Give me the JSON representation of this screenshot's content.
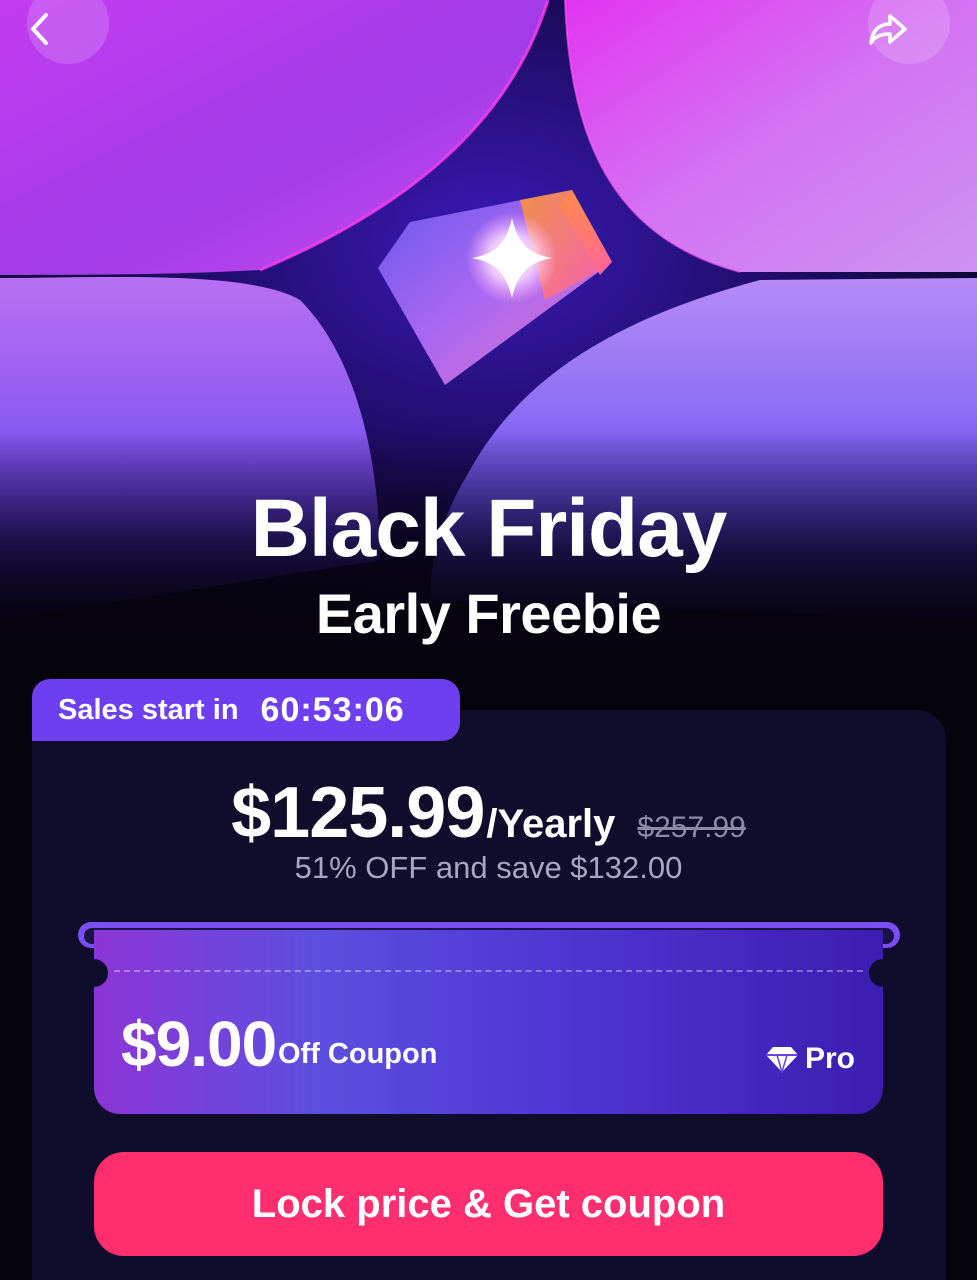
{
  "hero": {
    "title": "Black Friday",
    "subtitle": "Early Freebie",
    "back_icon": "chevron-left-icon",
    "share_icon": "share-arrow-icon"
  },
  "countdown": {
    "label": "Sales start in",
    "value": "60:53:06"
  },
  "pricing": {
    "price": "$125.99",
    "period": "/Yearly",
    "original_price": "$257.99",
    "savings_text": "51% OFF and save $132.00"
  },
  "coupon": {
    "amount": "$9.00",
    "label": "Off Coupon",
    "badge": "Pro",
    "badge_icon": "diamond-icon"
  },
  "cta": {
    "label": "Lock price & Get coupon"
  },
  "colors": {
    "background": "#05030c",
    "card": "#0f0c2c",
    "accent_purple": "#6d3ff0",
    "cta_pink": "#ff2f6f"
  }
}
